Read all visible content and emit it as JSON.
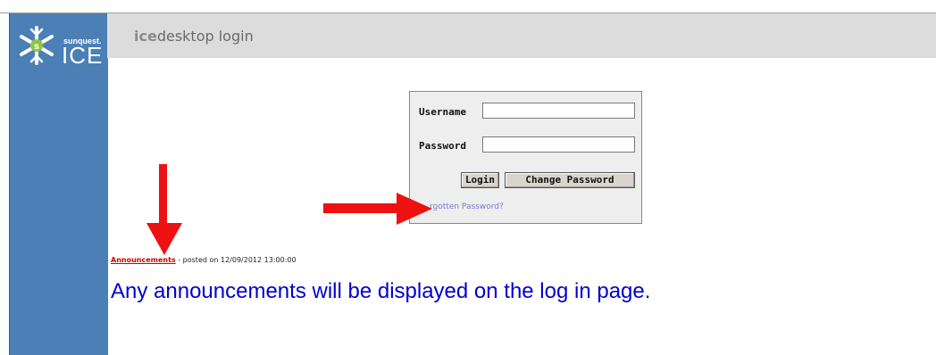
{
  "logo": {
    "brand": "sunquest.",
    "product": "ICE"
  },
  "header": {
    "title_prefix": "ice",
    "title_suffix": "desktop login"
  },
  "login": {
    "username_label": "Username",
    "password_label": "Password",
    "username_value": "",
    "password_value": "",
    "login_button": "Login",
    "change_password_button": "Change Password",
    "forgotten_password_link": "rgotten Password?"
  },
  "announcement": {
    "link_text": "Announcements",
    "posted_text": " - posted on 12/09/2012 13:00:00",
    "message": "Any announcements will be displayed on the log in page."
  },
  "colors": {
    "sidebar": "#4b7fb6",
    "header": "#dcdcdc",
    "arrow": "#ee1111",
    "announcement_message": "#0000cc"
  }
}
